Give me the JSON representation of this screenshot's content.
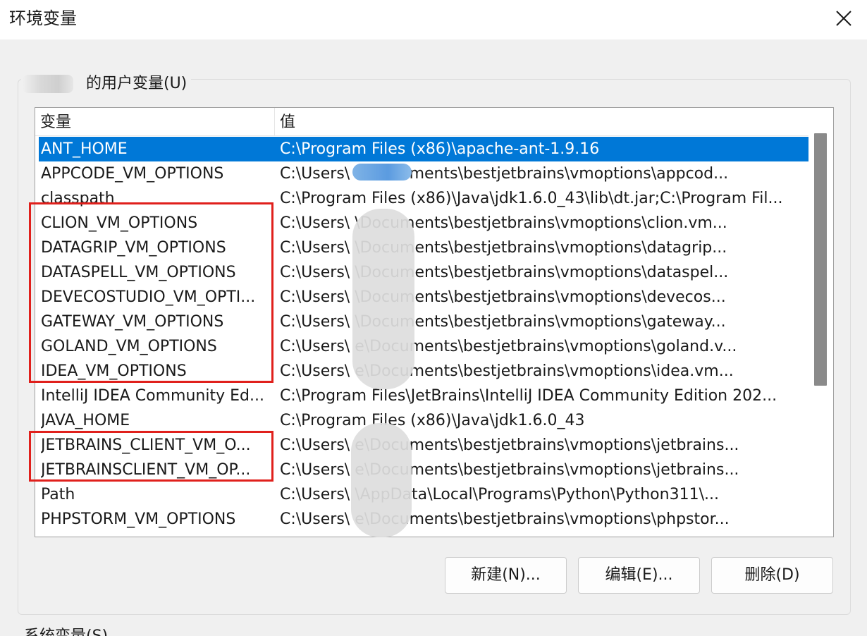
{
  "window": {
    "title": "环境变量",
    "close_icon": "close-icon"
  },
  "user_variables": {
    "group_label": "的用户变量(U)",
    "columns": {
      "variable": "变量",
      "value": "值"
    },
    "rows": [
      {
        "name": "ANT_HOME",
        "value": "C:\\Program Files (x86)\\apache-ant-1.9.16",
        "selected": true
      },
      {
        "name": "APPCODE_VM_OPTIONS",
        "value": "C:\\Users\\                    e\\Documents\\bestjetbrains\\vmoptions\\appcod..."
      },
      {
        "name": "classpath",
        "value": "C:\\Program Files (x86)\\Java\\jdk1.6.0_43\\lib\\dt.jar;C:\\Program Fil..."
      },
      {
        "name": "CLION_VM_OPTIONS",
        "value": "C:\\Users\\                    \\Documents\\bestjetbrains\\vmoptions\\clion.vm..."
      },
      {
        "name": "DATAGRIP_VM_OPTIONS",
        "value": "C:\\Users\\                    \\Documents\\bestjetbrains\\vmoptions\\datagrip..."
      },
      {
        "name": "DATASPELL_VM_OPTIONS",
        "value": "C:\\Users\\                    \\Documents\\bestjetbrains\\vmoptions\\dataspel..."
      },
      {
        "name": "DEVECOSTUDIO_VM_OPTI...",
        "value": "C:\\Users\\                    \\Documents\\bestjetbrains\\vmoptions\\devecos..."
      },
      {
        "name": "GATEWAY_VM_OPTIONS",
        "value": "C:\\Users\\                    \\Documents\\bestjetbrains\\vmoptions\\gateway..."
      },
      {
        "name": "GOLAND_VM_OPTIONS",
        "value": "C:\\Users\\                    e\\Documents\\bestjetbrains\\vmoptions\\goland.v..."
      },
      {
        "name": "IDEA_VM_OPTIONS",
        "value": "C:\\Users\\                    e\\Documents\\bestjetbrains\\vmoptions\\idea.vm..."
      },
      {
        "name": "IntelliJ IDEA Community Ed...",
        "value": "C:\\Program Files\\JetBrains\\IntelliJ IDEA Community Edition 202..."
      },
      {
        "name": "JAVA_HOME",
        "value": "C:\\Program Files (x86)\\Java\\jdk1.6.0_43"
      },
      {
        "name": "JETBRAINS_CLIENT_VM_O...",
        "value": "C:\\Users\\                    e\\Documents\\bestjetbrains\\vmoptions\\jetbrains..."
      },
      {
        "name": "JETBRAINSCLIENT_VM_OP...",
        "value": "C:\\Users\\                    e\\Documents\\bestjetbrains\\vmoptions\\jetbrains..."
      },
      {
        "name": "Path",
        "value": "C:\\Users\\                    \\AppData\\Local\\Programs\\Python\\Python311\\..."
      },
      {
        "name": "PHPSTORM_VM_OPTIONS",
        "value": "C:\\Users\\                    e\\Documents\\bestjetbrains\\vmoptions\\phpstor..."
      }
    ],
    "buttons": {
      "new": "新建(N)...",
      "edit": "编辑(E)...",
      "delete": "删除(D)"
    }
  },
  "system_variables": {
    "group_label": "系统变量(S)"
  },
  "colors": {
    "selection": "#0078d7",
    "highlight_box": "#e0201c"
  }
}
